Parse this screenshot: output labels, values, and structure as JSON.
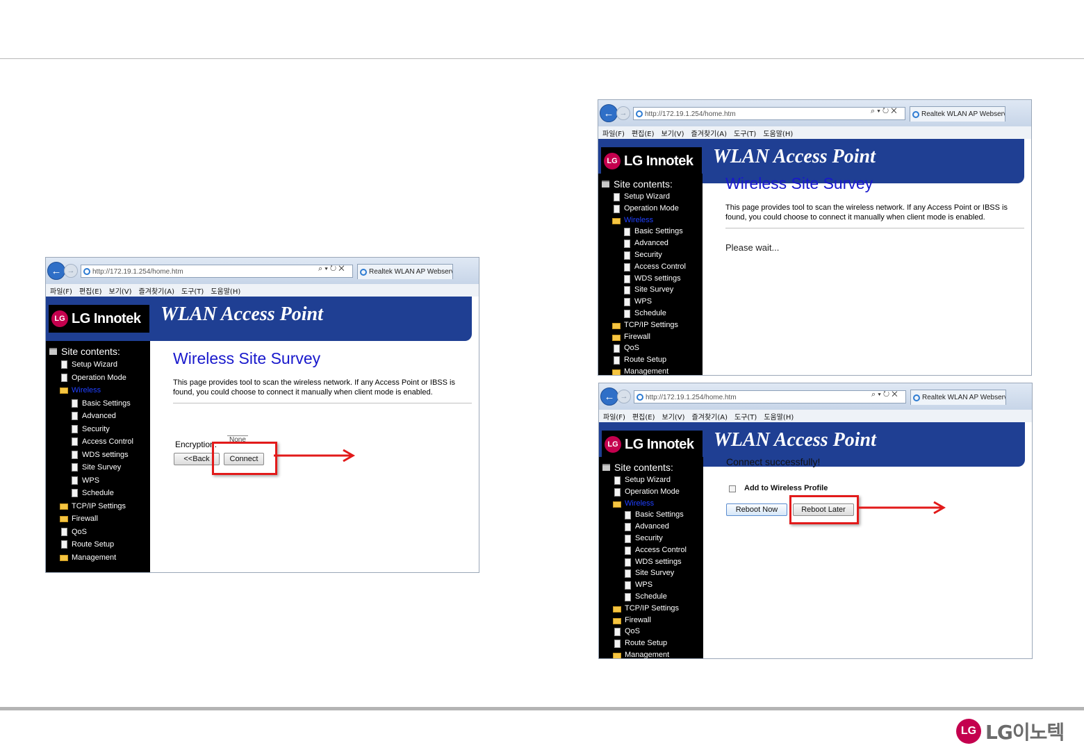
{
  "browser": {
    "url": "http://172.19.1.254/home.htm",
    "tab_title": "Realtek WLAN AP Webserver",
    "url_controls": "⌕ ▾ ↻ ✕",
    "menu": [
      "파일(F)",
      "편집(E)",
      "보기(V)",
      "즐겨찾기(A)",
      "도구(T)",
      "도움말(H)"
    ]
  },
  "app": {
    "brand": "LG Innotek",
    "product_title": "WLAN Access Point",
    "site_contents": "Site contents:",
    "nav": [
      {
        "label": "Setup Wizard",
        "level": 1,
        "icon": "page"
      },
      {
        "label": "Operation Mode",
        "level": 1,
        "icon": "page"
      },
      {
        "label": "Wireless",
        "level": 1,
        "icon": "folder-open"
      },
      {
        "label": "Basic Settings",
        "level": 2,
        "icon": "page"
      },
      {
        "label": "Advanced",
        "level": 2,
        "icon": "page"
      },
      {
        "label": "Security",
        "level": 2,
        "icon": "page"
      },
      {
        "label": "Access Control",
        "level": 2,
        "icon": "page"
      },
      {
        "label": "WDS settings",
        "level": 2,
        "icon": "page"
      },
      {
        "label": "Site Survey",
        "level": 2,
        "icon": "page"
      },
      {
        "label": "WPS",
        "level": 2,
        "icon": "page"
      },
      {
        "label": "Schedule",
        "level": 2,
        "icon": "page"
      },
      {
        "label": "TCP/IP Settings",
        "level": 1,
        "icon": "folder"
      },
      {
        "label": "Firewall",
        "level": 1,
        "icon": "folder"
      },
      {
        "label": "QoS",
        "level": 1,
        "icon": "page"
      },
      {
        "label": "Route Setup",
        "level": 1,
        "icon": "page"
      },
      {
        "label": "Management",
        "level": 1,
        "icon": "folder"
      }
    ]
  },
  "screen1": {
    "page_title": "Wireless Site Survey",
    "description": "This page provides tool to scan the wireless network. If any Access Point or IBSS is found, you could choose to connect it manually when client mode is enabled.",
    "encryption_label": "Encryption:",
    "encryption_value": "None",
    "back_label": "<<Back",
    "connect_label": "Connect"
  },
  "screen2": {
    "page_title": "Wireless Site Survey",
    "description": "This page provides tool to scan the wireless network. If any Access Point or IBSS is found, you could choose to connect it manually when client mode is enabled.",
    "status": "Please wait..."
  },
  "screen3": {
    "message": "Connect successfully!",
    "checkbox_label": "Add to Wireless Profile",
    "reboot_now_label": "Reboot Now",
    "reboot_later_label": "Reboot Later"
  },
  "footer": {
    "logo_mark": "LG",
    "logo_text": "LG이노텍"
  },
  "colors": {
    "header_blue": "#1f3f93",
    "title_blue": "#1818cc",
    "highlight_red": "#e21a1a",
    "brand_magenta": "#c4004e"
  }
}
